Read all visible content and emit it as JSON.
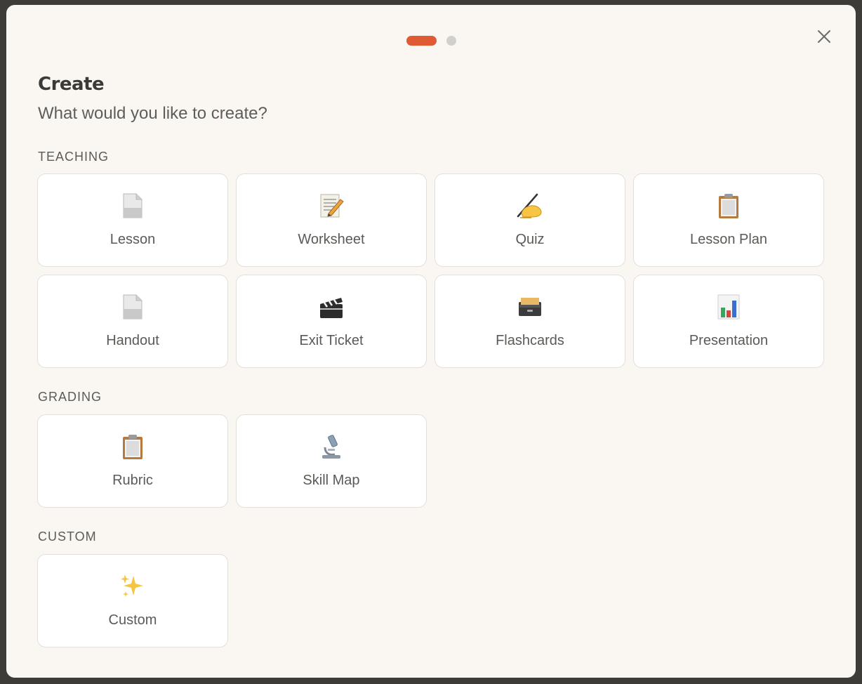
{
  "modal": {
    "title": "Create",
    "subtitle": "What would you like to create?"
  },
  "pager": {
    "current_page": 1,
    "total_pages": 2
  },
  "colors": {
    "accent": "#e05a33",
    "background": "#faf7f2",
    "card": "#ffffff"
  },
  "sections": [
    {
      "label": "TEACHING",
      "items": [
        {
          "label": "Lesson",
          "icon": "page-icon"
        },
        {
          "label": "Worksheet",
          "icon": "memo-icon"
        },
        {
          "label": "Quiz",
          "icon": "writing-hand-icon"
        },
        {
          "label": "Lesson Plan",
          "icon": "clipboard-icon"
        },
        {
          "label": "Handout",
          "icon": "page-icon"
        },
        {
          "label": "Exit Ticket",
          "icon": "clapper-board-icon"
        },
        {
          "label": "Flashcards",
          "icon": "card-file-box-icon"
        },
        {
          "label": "Presentation",
          "icon": "bar-chart-icon"
        }
      ]
    },
    {
      "label": "GRADING",
      "items": [
        {
          "label": "Rubric",
          "icon": "clipboard-icon"
        },
        {
          "label": "Skill Map",
          "icon": "microscope-icon"
        }
      ]
    },
    {
      "label": "CUSTOM",
      "items": [
        {
          "label": "Custom",
          "icon": "sparkles-icon"
        }
      ]
    }
  ]
}
